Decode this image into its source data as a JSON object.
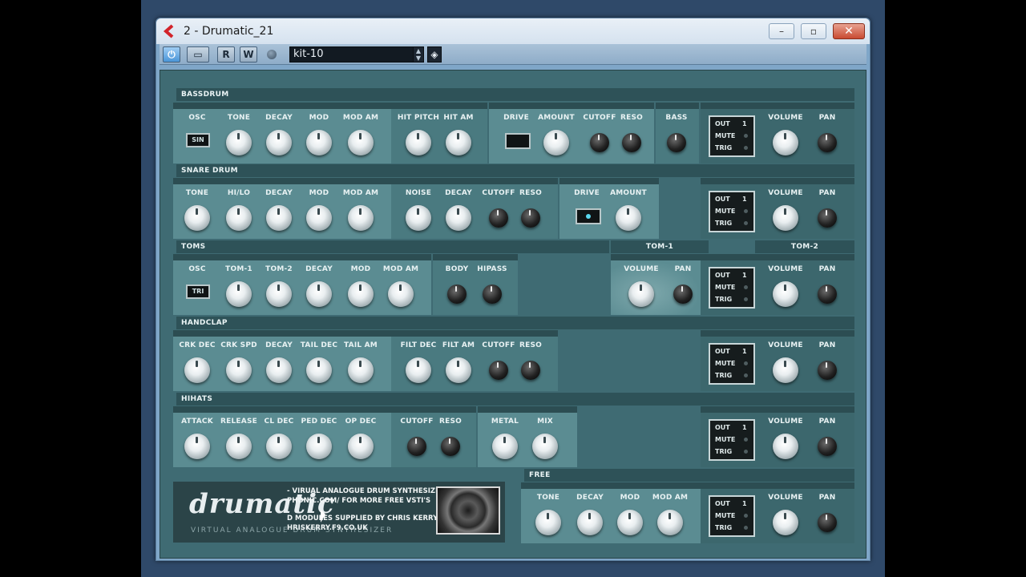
{
  "window": {
    "title": "2 - Drumatic_21",
    "min_symbol": "–",
    "max_symbol": "▫",
    "close_symbol": "✕"
  },
  "toolbar": {
    "power": "⏻",
    "bypass": "▭",
    "read": "R",
    "write": "W",
    "preset": "kit-10",
    "spin": "▲\n▼",
    "menu": "◈"
  },
  "sections": {
    "bassdrum": "BASSDRUM",
    "snare": "SNARE DRUM",
    "toms": "TOMS",
    "tom1": "TOM-1",
    "tom2": "TOM-2",
    "handclap": "HANDCLAP",
    "hihats": "HIHATS",
    "free": "FREE"
  },
  "labels": {
    "osc": "OSC",
    "tone": "TONE",
    "decay": "DECAY",
    "mod": "MOD",
    "mod_am": "MOD AM",
    "hit_pitch": "HIT PITCH",
    "hit_am": "HIT AM",
    "drive": "DRIVE",
    "amount": "AMOUNT",
    "cutoff": "CUTOFF",
    "reso": "RESO",
    "bass": "BASS",
    "volume": "VOLUME",
    "pan": "PAN",
    "hi_lo": "HI/LO",
    "noise": "NOISE",
    "tom_1": "TOM-1",
    "tom_2": "TOM-2",
    "body": "BODY",
    "hipass": "HIPASS",
    "crk_dec": "CRK DEC",
    "crk_spd": "CRK SPD",
    "tail_dec": "TAIL DEC",
    "tail_am": "TAIL AM",
    "filt_dec": "FILT DEC",
    "filt_am": "FILT AM",
    "attack": "ATTACK",
    "release": "RELEASE",
    "cl_dec": "CL DEC",
    "ped_dec": "PED DEC",
    "op_dec": "OP DEC",
    "metal": "METAL",
    "mix": "MIX"
  },
  "switches": {
    "sin": "SIN",
    "tri": "TRI"
  },
  "out": {
    "out": "OUT",
    "mute": "MUTE",
    "trig": "TRIG",
    "num": "1"
  },
  "logo": {
    "word": "drumatic",
    "sub": "VIRTUAL ANALOGUE DRUM SYNTHESIZER",
    "credit1": "- VIRUAL ANALOGUE DRUM SYNTHESIZER",
    "credit2": "PHONIC.COM/  FOR MORE FREE VSTI'S",
    "credit3": "D MODULES SUPPLIED BY CHRIS KERRY",
    "credit4": "HRISKERRY.F9.CO.UK"
  }
}
